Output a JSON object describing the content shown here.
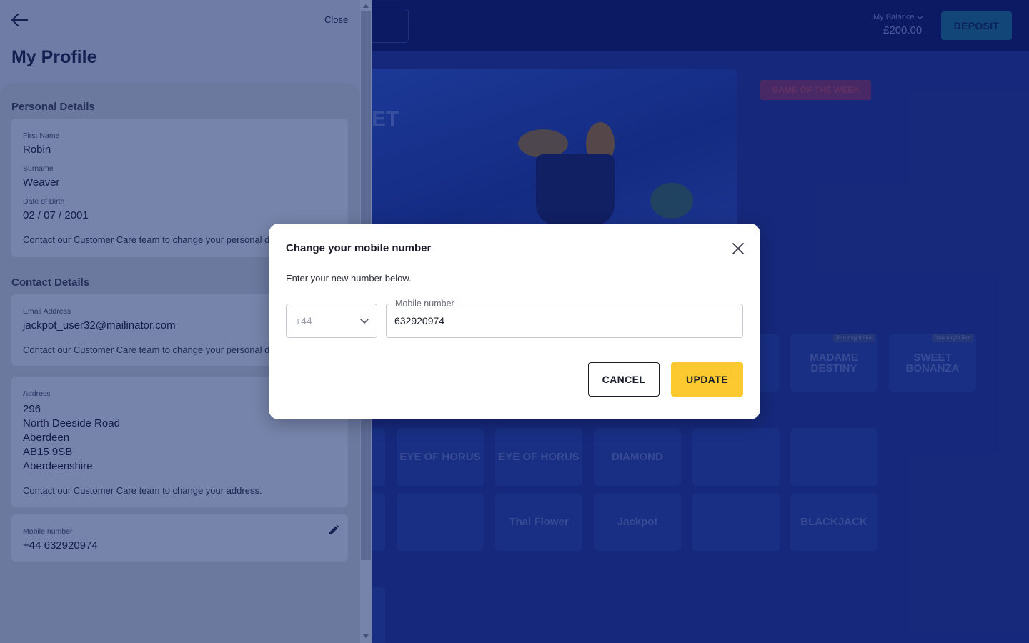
{
  "header": {
    "balance_label": "My Balance",
    "balance_value": "£200.00",
    "deposit_label": "DEPOSIT"
  },
  "background": {
    "hero_text": "ET",
    "game_of_week_label": "GAME OF THE WEEK",
    "might_like_tag": "You might like",
    "tiles_row1": [
      "MADAME DESTINY",
      "SWEET BONANZA"
    ],
    "tiles_row2": [
      "EYE OF HORUS",
      "EYE OF HORUS",
      "DIAMOND",
      "",
      ""
    ],
    "tiles_row3": [
      "",
      "Thai Flower",
      "Jackpot",
      "",
      "BLACKJACK"
    ]
  },
  "drawer": {
    "close_label": "Close",
    "title": "My Profile",
    "personal": {
      "section_title": "Personal Details",
      "first_name_label": "First Name",
      "first_name": "Robin",
      "surname_label": "Surname",
      "surname": "Weaver",
      "dob_label": "Date of Birth",
      "dob": "02 / 07 / 2001",
      "note": "Contact our Customer Care team to change your personal details."
    },
    "contact": {
      "section_title": "Contact Details",
      "email_label": "Email Address",
      "email": "jackpot_user32@mailinator.com",
      "email_note": "Contact our Customer Care team to change your personal details.",
      "address_label": "Address",
      "address_lines": [
        "296",
        "North Deeside Road",
        "Aberdeen",
        "AB15 9SB",
        "Aberdeenshire"
      ],
      "address_note": "Contact our Customer Care team to change your address.",
      "mobile_label": "Mobile number",
      "mobile": "+44 632920974"
    }
  },
  "modal": {
    "title": "Change your mobile number",
    "description": "Enter your new number below.",
    "country_code": "+44",
    "mobile_label": "Mobile number",
    "mobile_value": "632920974",
    "cancel_label": "CANCEL",
    "update_label": "UPDATE"
  },
  "colors": {
    "accent": "#fcc930",
    "modal_bg": "#ffffff",
    "drawer_bg": "#6f7da6"
  }
}
